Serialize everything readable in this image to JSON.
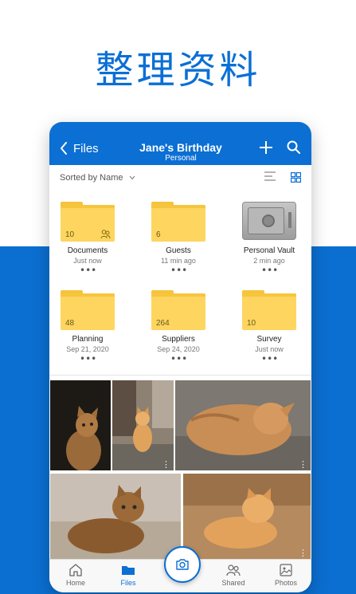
{
  "hero": {
    "title": "整理资料"
  },
  "colors": {
    "accent": "#0c6fd3",
    "folder": "#fdd55f",
    "band": "#0b6fd1"
  },
  "header": {
    "back_label": "Files",
    "title": "Jane's Birthday",
    "subtitle": "Personal",
    "icons": [
      "chevron-left-icon",
      "plus-icon",
      "search-icon"
    ]
  },
  "sortbar": {
    "sort_label": "Sorted by Name",
    "view_icons": [
      "list-view-icon",
      "grid-view-icon"
    ]
  },
  "folders": [
    {
      "name": "Documents",
      "meta": "Just now",
      "count": "10",
      "kind": "folder",
      "shared": true
    },
    {
      "name": "Guests",
      "meta": "11 min ago",
      "count": "6",
      "kind": "folder",
      "shared": false
    },
    {
      "name": "Personal Vault",
      "meta": "2 min ago",
      "count": "",
      "kind": "vault",
      "shared": false
    },
    {
      "name": "Planning",
      "meta": "Sep 21, 2020",
      "count": "48",
      "kind": "folder",
      "shared": false
    },
    {
      "name": "Suppliers",
      "meta": "Sep 24, 2020",
      "count": "264",
      "kind": "folder",
      "shared": false
    },
    {
      "name": "Survey",
      "meta": "Just now",
      "count": "10",
      "kind": "folder",
      "shared": false
    }
  ],
  "more_glyph": "•••",
  "photos": [
    {
      "subject": "cat-looking-up"
    },
    {
      "subject": "cat-sitting-street"
    },
    {
      "subject": "cat-lying-on-back"
    },
    {
      "subject": "cat-lying-down"
    },
    {
      "subject": "cat-lying-floor"
    }
  ],
  "tabbar": {
    "items": [
      {
        "label": "Home",
        "icon": "home-icon",
        "active": false
      },
      {
        "label": "Files",
        "icon": "folder-icon",
        "active": true
      },
      {
        "label": "Shared",
        "icon": "people-icon",
        "active": false
      },
      {
        "label": "Photos",
        "icon": "photo-icon",
        "active": false
      }
    ],
    "camera_icon": "camera-icon"
  }
}
